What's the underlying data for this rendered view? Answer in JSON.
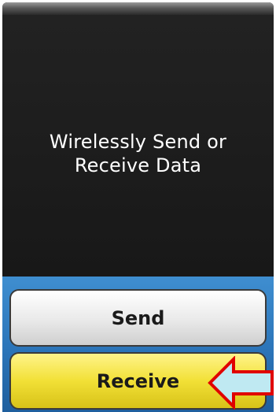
{
  "message": {
    "line1": "Wirelessly Send or",
    "line2": "Receive Data"
  },
  "buttons": {
    "send_label": "Send",
    "receive_label": "Receive"
  },
  "annotation": {
    "icon": "left-arrow-icon",
    "fill_color": "#bfe9f2",
    "stroke_color": "#e00000"
  },
  "colors": {
    "screen_background": "#1b1b1b",
    "panel_blue": "#2b74b8",
    "send_button": "#e9e9e9",
    "receive_button": "#f2e036"
  }
}
